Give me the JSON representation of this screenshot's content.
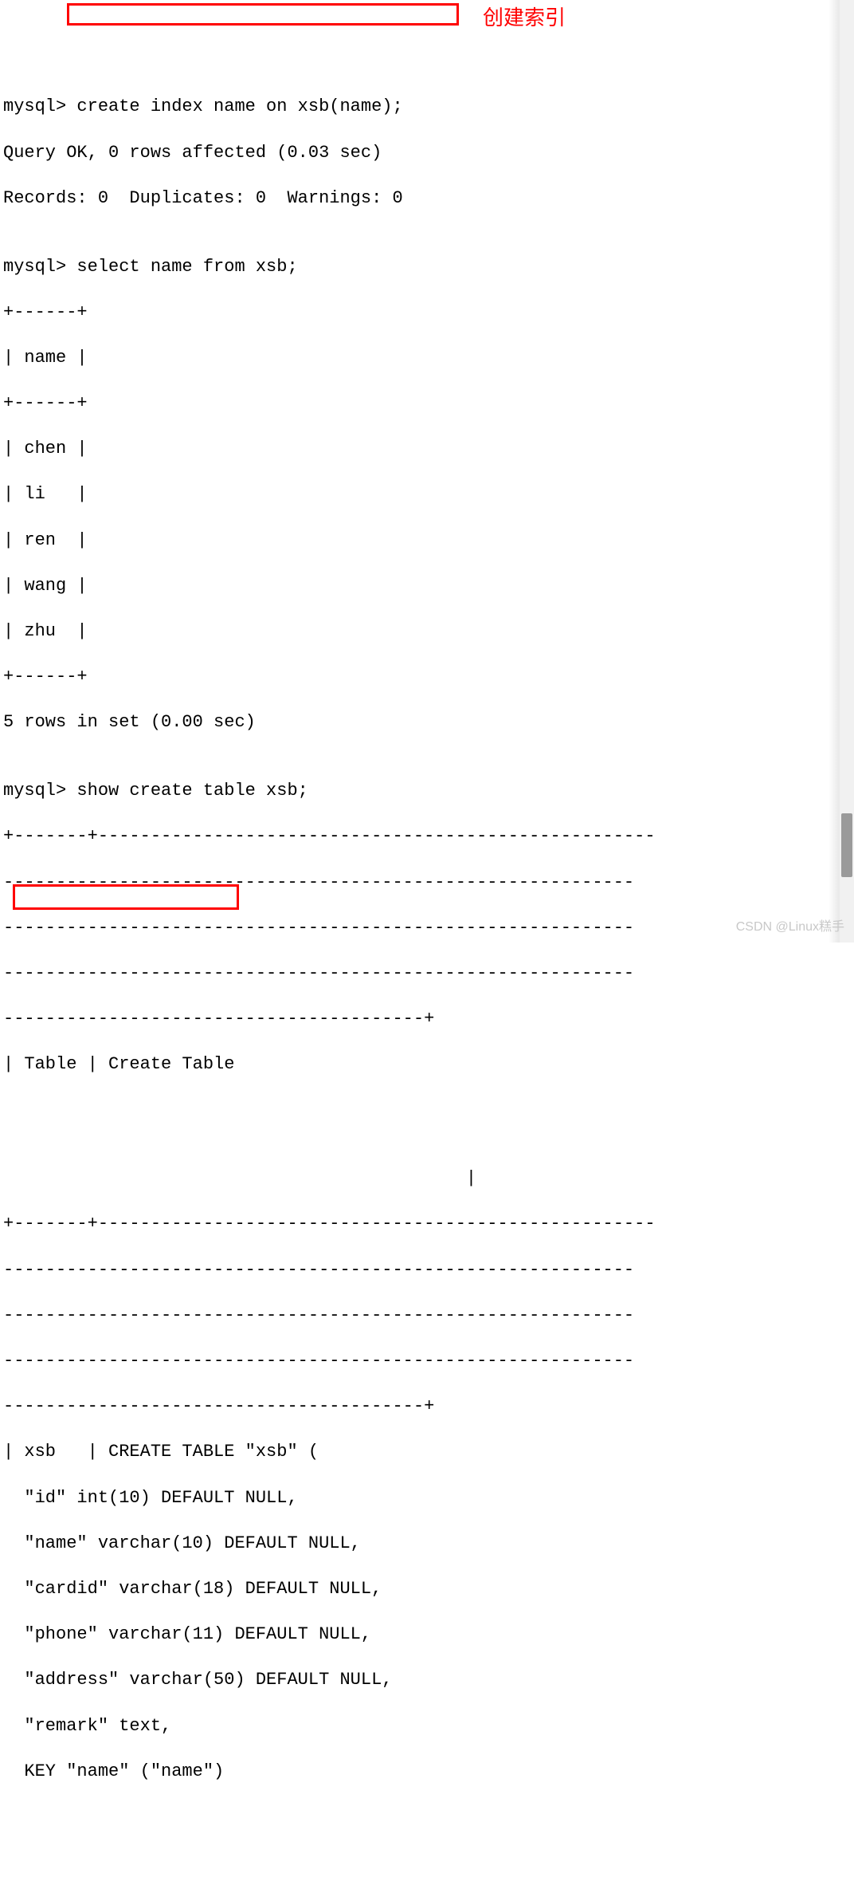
{
  "annotation": "创建索引",
  "watermark": "CSDN @Linux糕手",
  "lines": [
    "mysql> create index name on xsb(name);",
    "Query OK, 0 rows affected (0.03 sec)",
    "Records: 0  Duplicates: 0  Warnings: 0",
    "",
    "mysql> select name from xsb;",
    "+------+",
    "| name |",
    "+------+",
    "| chen |",
    "| li   |",
    "| ren  |",
    "| wang |",
    "| zhu  |",
    "+------+",
    "5 rows in set (0.00 sec)",
    "",
    "mysql> show create table xsb;",
    "+-------+-----------------------------------------------------",
    "------------------------------------------------------------",
    "------------------------------------------------------------",
    "------------------------------------------------------------",
    "----------------------------------------+",
    "| Table | Create Table",
    "",
    "",
    "",
    "                                            |",
    "+-------+-----------------------------------------------------",
    "------------------------------------------------------------",
    "------------------------------------------------------------",
    "------------------------------------------------------------",
    "----------------------------------------+",
    "| xsb   | CREATE TABLE \"xsb\" (",
    "  \"id\" int(10) DEFAULT NULL,",
    "  \"name\" varchar(10) DEFAULT NULL,",
    "  \"cardid\" varchar(18) DEFAULT NULL,",
    "  \"phone\" varchar(11) DEFAULT NULL,",
    "  \"address\" varchar(50) DEFAULT NULL,",
    "  \"remark\" text,",
    "  KEY \"name\" (\"name\")"
  ]
}
